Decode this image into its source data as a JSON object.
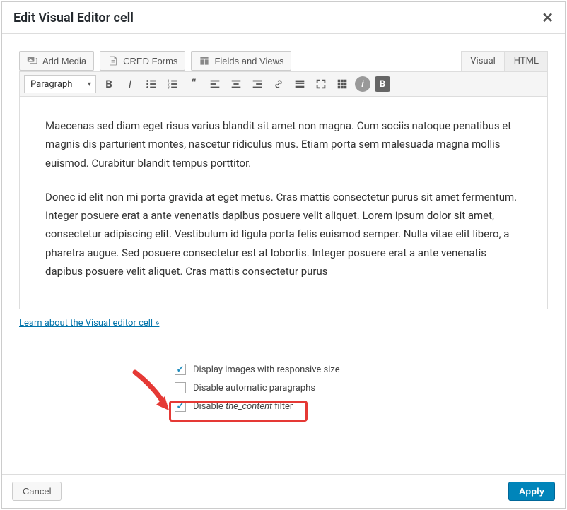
{
  "dialog": {
    "title": "Edit Visual Editor cell"
  },
  "media_buttons": {
    "add_media": "Add Media",
    "cred_forms": "CRED Forms",
    "fields_views": "Fields and Views"
  },
  "tabs": {
    "visual": "Visual",
    "html": "HTML"
  },
  "toolbar": {
    "format": "Paragraph"
  },
  "editor": {
    "p1": "Maecenas sed diam eget risus varius blandit sit amet non magna. Cum sociis natoque penatibus et magnis dis parturient montes, nascetur ridiculus mus. Etiam porta sem malesuada magna mollis euismod. Curabitur blandit tempus porttitor.",
    "p2": "Donec id elit non mi porta gravida at eget metus. Cras mattis consectetur purus sit amet fermentum. Integer posuere erat a ante venenatis dapibus posuere velit aliquet. Lorem ipsum dolor sit amet, consectetur adipiscing elit. Vestibulum id ligula porta felis euismod semper. Nulla vitae elit libero, a pharetra augue. Sed posuere consectetur est at lobortis. Integer posuere erat a ante venenatis dapibus posuere velit aliquet. Cras mattis consectetur purus"
  },
  "link": {
    "learn": "Learn about the Visual editor cell »"
  },
  "options": {
    "responsive": "Display images with responsive size",
    "autoparagraphs": "Disable automatic paragraphs",
    "filter_pre": "Disable ",
    "filter_em": "the_content",
    "filter_post": " filter"
  },
  "footer": {
    "cancel": "Cancel",
    "apply": "Apply"
  }
}
